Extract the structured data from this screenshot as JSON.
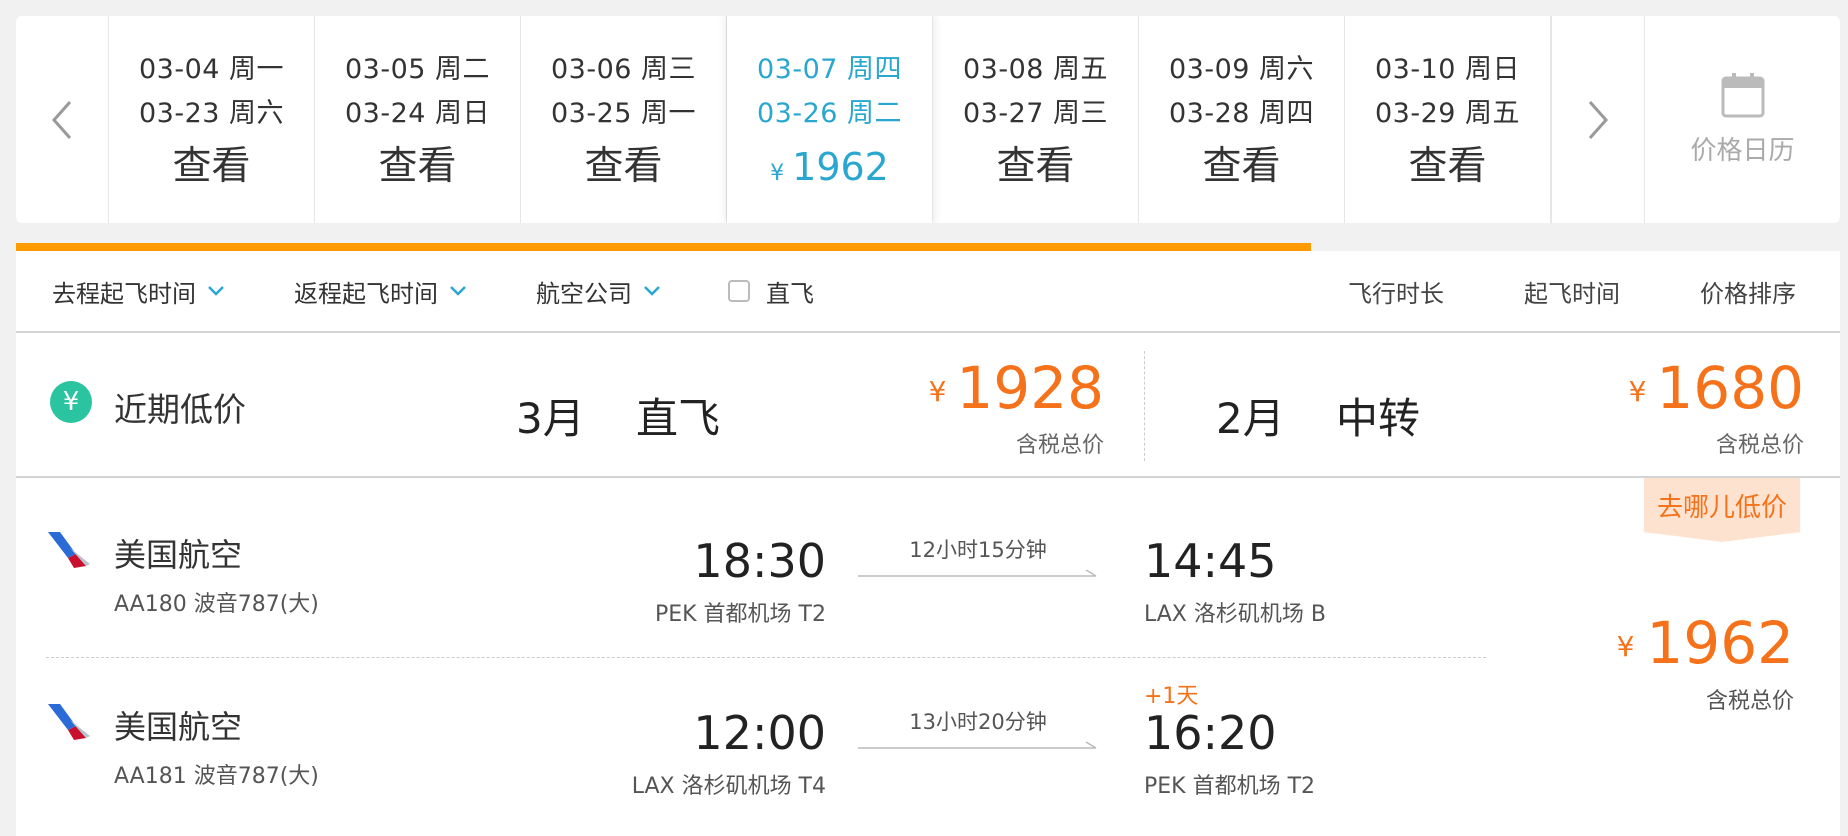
{
  "dates": [
    {
      "out": "03-04 周一",
      "ret": "03-23 周六",
      "label": "查看"
    },
    {
      "out": "03-05 周二",
      "ret": "03-24 周日",
      "label": "查看"
    },
    {
      "out": "03-06 周三",
      "ret": "03-25 周一",
      "label": "查看"
    },
    {
      "out": "03-07 周四",
      "ret": "03-26 周二",
      "currency": "¥",
      "price": "1962",
      "active": true
    },
    {
      "out": "03-08 周五",
      "ret": "03-27 周三",
      "label": "查看"
    },
    {
      "out": "03-09 周六",
      "ret": "03-28 周四",
      "label": "查看"
    },
    {
      "out": "03-10 周日",
      "ret": "03-29 周五",
      "label": "查看"
    }
  ],
  "calendar_label": "价格日历",
  "progress": 0.71,
  "filters": {
    "depart_time": "去程起飞时间",
    "return_time": "返程起飞时间",
    "airline": "航空公司",
    "direct": "直飞"
  },
  "sort": {
    "duration": "飞行时长",
    "depart": "起飞时间",
    "price": "价格排序"
  },
  "low_price": {
    "title": "近期低价",
    "icon": "yuan-icon",
    "options": [
      {
        "month": "3月",
        "type": "直飞",
        "currency": "¥",
        "price": "1928",
        "sub": "含税总价"
      },
      {
        "month": "2月",
        "type": "中转",
        "currency": "¥",
        "price": "1680",
        "sub": "含税总价"
      }
    ]
  },
  "flight": {
    "promo": "去哪儿低价",
    "currency": "¥",
    "price": "1962",
    "price_sub": "含税总价",
    "legs": [
      {
        "airline": "美国航空",
        "flight": "AA180 波音787(大)",
        "dep_time": "18:30",
        "dep_airport": "PEK 首都机场 T2",
        "duration": "12小时15分钟",
        "arr_time": "14:45",
        "arr_airport": "LAX 洛杉矶机场 B",
        "plus": ""
      },
      {
        "airline": "美国航空",
        "flight": "AA181 波音787(大)",
        "dep_time": "12:00",
        "dep_airport": "LAX 洛杉矶机场 T4",
        "duration": "13小时20分钟",
        "arr_time": "16:20",
        "arr_airport": "PEK 首都机场 T2",
        "plus": "+1天"
      }
    ]
  },
  "colors": {
    "accent": "#2aa7cf",
    "price": "#f5721b",
    "progress": "#ff9a00",
    "yuan": "#2bc4a0"
  }
}
